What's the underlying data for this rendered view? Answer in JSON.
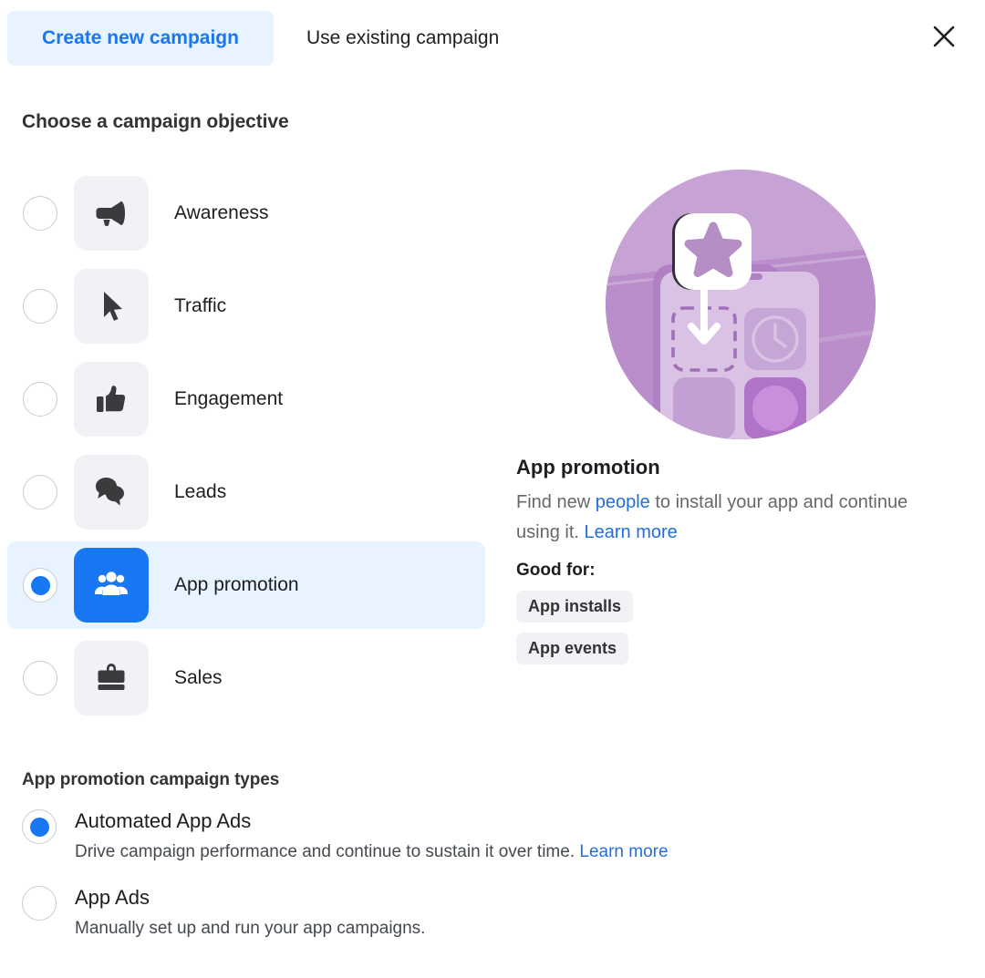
{
  "header": {
    "tabs": [
      {
        "label": "Create new campaign",
        "active": true
      },
      {
        "label": "Use existing campaign",
        "active": false
      }
    ],
    "close_icon": "close-icon"
  },
  "objective_section": {
    "heading": "Choose a campaign objective",
    "options": [
      {
        "label": "Awareness",
        "icon": "megaphone-icon",
        "selected": false
      },
      {
        "label": "Traffic",
        "icon": "cursor-icon",
        "selected": false
      },
      {
        "label": "Engagement",
        "icon": "thumbs-up-icon",
        "selected": false
      },
      {
        "label": "Leads",
        "icon": "speech-bubbles-icon",
        "selected": false
      },
      {
        "label": "App promotion",
        "icon": "people-group-icon",
        "selected": true
      },
      {
        "label": "Sales",
        "icon": "briefcase-icon",
        "selected": false
      }
    ]
  },
  "detail_panel": {
    "illustration": "app-promotion-illustration",
    "title": "App promotion",
    "description_part1": "Find new ",
    "description_link1": "people",
    "description_part2": " to install your app and continue using it. ",
    "description_link2": "Learn more",
    "good_for_label": "Good for:",
    "tags": [
      "App installs",
      "App events"
    ]
  },
  "campaign_types_section": {
    "heading": "App promotion campaign types",
    "options": [
      {
        "title": "Automated App Ads",
        "description": "Drive campaign performance and continue to sustain it over time. ",
        "link": "Learn more",
        "selected": true
      },
      {
        "title": "App Ads",
        "description": "Manually set up and run your app campaigns.",
        "link": "",
        "selected": false
      }
    ]
  },
  "colors": {
    "accent_blue": "#1877f2",
    "link_blue": "#216fdb",
    "tab_active_bg": "#e7f3ff",
    "tile_bg": "#f0f2f5",
    "selected_row_bg": "#e7f3ff",
    "illustration_purple": "#b48ec4"
  }
}
